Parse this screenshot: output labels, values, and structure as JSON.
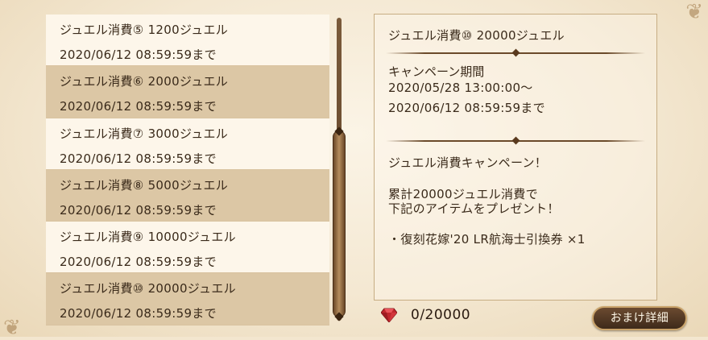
{
  "campaign_list": [
    {
      "name": "ジュエル消費⑤ 1200ジュエル",
      "deadline": "2020/06/12 08:59:59まで"
    },
    {
      "name": "ジュエル消費⑥ 2000ジュエル",
      "deadline": "2020/06/12 08:59:59まで"
    },
    {
      "name": "ジュエル消費⑦ 3000ジュエル",
      "deadline": "2020/06/12 08:59:59まで"
    },
    {
      "name": "ジュエル消費⑧ 5000ジュエル",
      "deadline": "2020/06/12 08:59:59まで"
    },
    {
      "name": "ジュエル消費⑨ 10000ジュエル",
      "deadline": "2020/06/12 08:59:59まで"
    },
    {
      "name": "ジュエル消費⑩ 20000ジュエル",
      "deadline": "2020/06/12 08:59:59まで"
    }
  ],
  "detail": {
    "title": "ジュエル消費⑩ 20000ジュエル",
    "period_label": "キャンペーン期間",
    "period_start": "2020/05/28 13:00:00～",
    "period_end": "2020/06/12 08:59:59まで",
    "description_heading": "ジュエル消費キャンペーン！",
    "description_line1": "累計20000ジュエル消費で",
    "description_line2": "下記のアイテムをプレゼント！",
    "reward_item": "・復刻花嫁'20 LR航海士引換券 ×1"
  },
  "status": {
    "gem_icon": "red-gem-icon",
    "progress_text": "0/20000"
  },
  "buttons": {
    "bonus_details_label": "おまけ詳細"
  },
  "colors": {
    "panel_bg": "#f4e8d2",
    "row_light": "#fdf6ea",
    "row_dark": "#dcc7a5",
    "text": "#3a2a1a",
    "button_bg": "#4e3522",
    "gem": "#c0272d"
  }
}
